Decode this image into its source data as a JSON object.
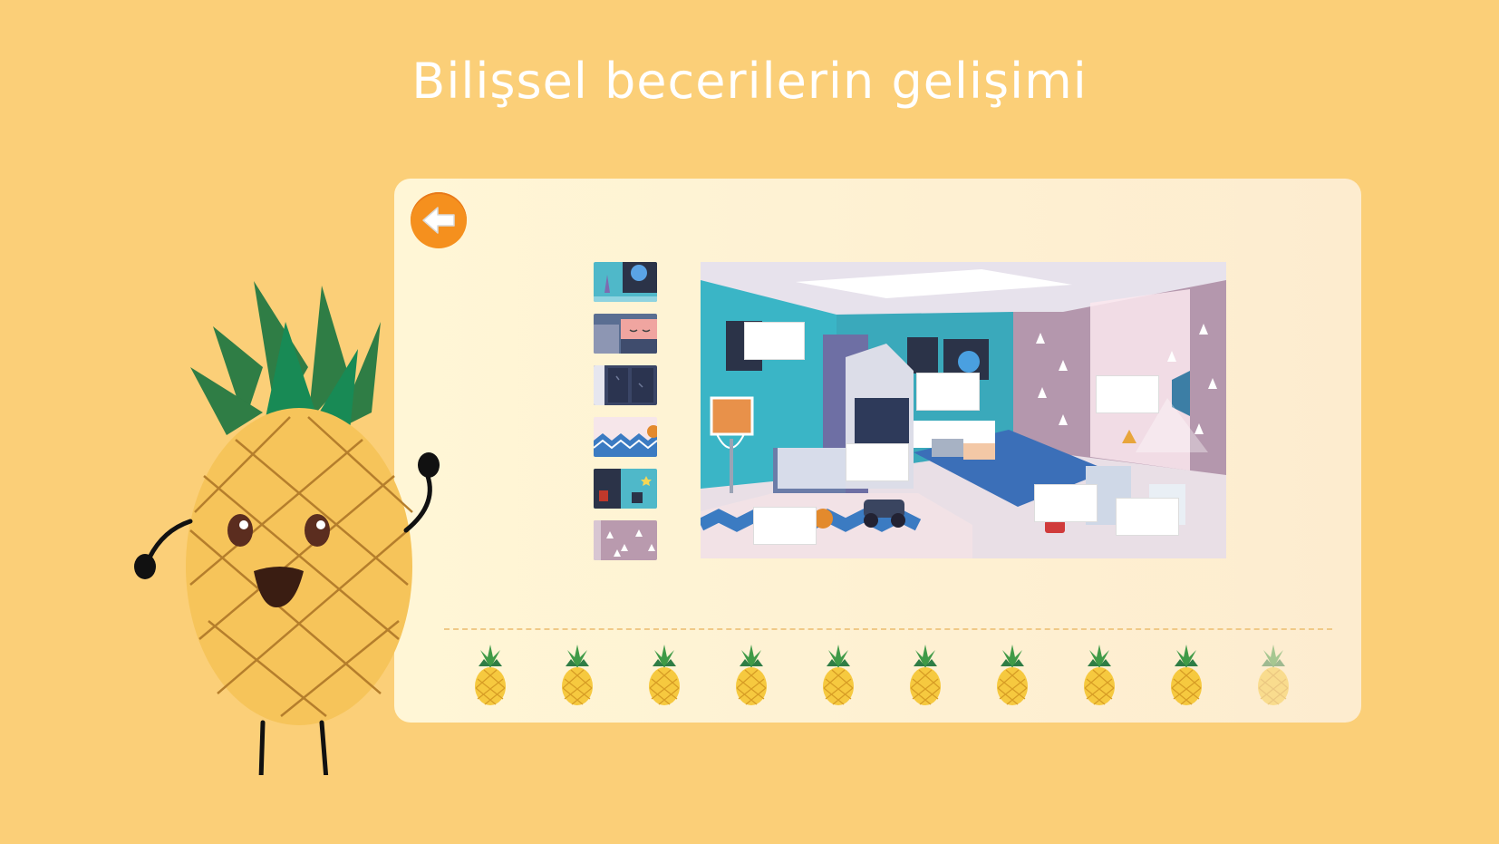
{
  "theme": {
    "background": "#fbcf78",
    "accent": "#f5901e",
    "panel": "#fff6d6"
  },
  "header": {
    "title": "Bilişsel becerilerin gelişimi"
  },
  "game": {
    "back_icon": "arrow-left-icon",
    "pieces": [
      {
        "name": "rocket-piece"
      },
      {
        "name": "pillow-piece"
      },
      {
        "name": "window-piece"
      },
      {
        "name": "rug-piece"
      },
      {
        "name": "poster-piece"
      },
      {
        "name": "curtain-piece"
      }
    ],
    "slots_count": 7,
    "progress": {
      "total": 10,
      "completed": 9
    }
  },
  "mascot": {
    "icon": "pineapple-mascot-icon"
  }
}
